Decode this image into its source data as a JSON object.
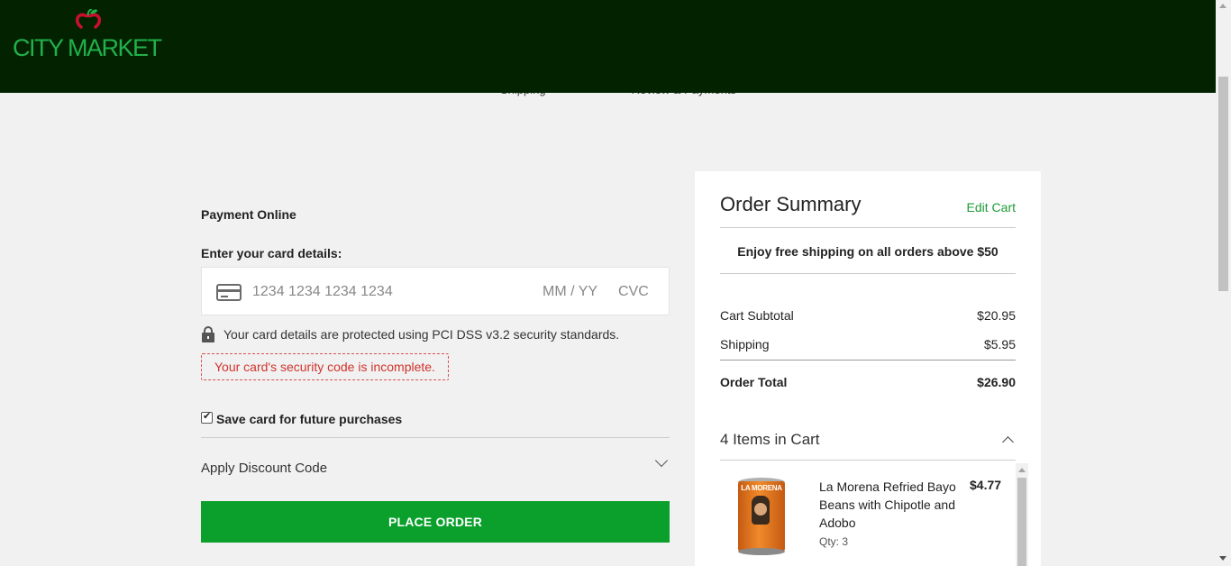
{
  "brand": {
    "name": "CITY MARKET",
    "colors": {
      "header_bg": "#032300",
      "logo_green": "#22b04a",
      "apple_red": "#c8102e",
      "accent_green": "#0aa02b"
    }
  },
  "steps": [
    "Shipping",
    "Review & Payments"
  ],
  "payment": {
    "section_title": "Payment Online",
    "card_label": "Enter your card details:",
    "card_number_placeholder": "1234 1234 1234 1234",
    "expiry_placeholder": "MM / YY",
    "cvc_placeholder": "CVC",
    "security_note": "Your card details are protected using PCI DSS v3.2 security standards.",
    "error_message": "Your card's security code is incomplete.",
    "save_card_label": "Save card for future purchases",
    "save_card_checked": true,
    "discount_label": "Apply Discount Code",
    "place_order_label": "PLACE ORDER"
  },
  "summary": {
    "title": "Order Summary",
    "edit_cart_label": "Edit Cart",
    "free_shipping_text": "Enjoy free shipping on all orders above $50",
    "subtotal_label": "Cart Subtotal",
    "subtotal_value": "$20.95",
    "shipping_label": "Shipping",
    "shipping_value": "$5.95",
    "total_label": "Order Total",
    "total_value": "$26.90",
    "items_heading": "4 Items in Cart",
    "items": [
      {
        "name": "La Morena Refried Bayo Beans with Chipotle and Adobo",
        "qty": "Qty: 3",
        "price": "$4.77",
        "image_label": "LA MORENA"
      }
    ]
  }
}
